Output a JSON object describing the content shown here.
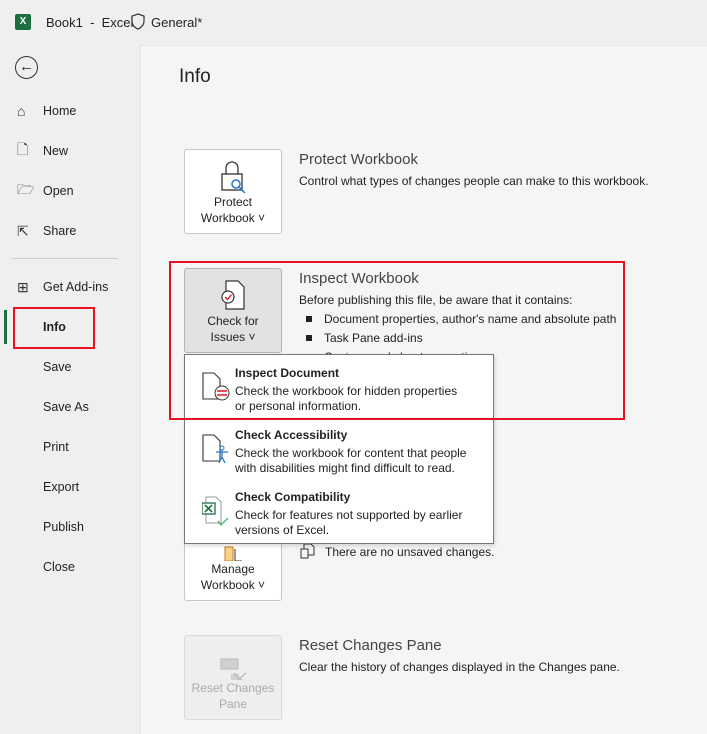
{
  "titlebar": {
    "app_icon": "excel-logo",
    "app_letter": "X",
    "title": "Book1  -  Excel",
    "sensitivity_icon": "shield-icon",
    "sensitivity_label": "General*"
  },
  "sidebar": {
    "back_icon": "back-arrow-icon",
    "items": [
      {
        "label": "Home",
        "icon": "home-icon"
      },
      {
        "label": "New",
        "icon": "new-doc-icon"
      },
      {
        "label": "Open",
        "icon": "folder-open-icon"
      },
      {
        "label": "Share",
        "icon": "share-icon"
      },
      {
        "label": "Get Add-ins",
        "icon": "grid-icon"
      },
      {
        "label": "Info",
        "selected": true
      },
      {
        "label": "Save"
      },
      {
        "label": "Save As"
      },
      {
        "label": "Print"
      },
      {
        "label": "Export"
      },
      {
        "label": "Publish"
      },
      {
        "label": "Close"
      }
    ],
    "accent": "#1d6f42"
  },
  "main": {
    "title": "Info",
    "protect": {
      "button_line1": "Protect",
      "button_line2": "Workbook ˅",
      "title": "Protect Workbook",
      "desc": "Control what types of changes people can make to this workbook."
    },
    "inspect": {
      "button_line1": "Check for",
      "button_line2": "Issues ˅",
      "title": "Inspect Workbook",
      "desc": "Before publishing this file, be aware that it contains:",
      "bullets": [
        "Document properties, author's name and absolute path",
        "Task Pane add-ins",
        "Custom worksheet properties"
      ]
    },
    "manage": {
      "button_line1": "Manage",
      "button_line2": "Workbook ˅",
      "status": "There are no unsaved changes."
    },
    "reset": {
      "button_line1": "Reset Changes",
      "button_line2": "Pane",
      "title": "Reset Changes Pane",
      "desc": "Clear the history of changes displayed in the Changes pane.",
      "disabled": true
    }
  },
  "dropdown": {
    "items": [
      {
        "title": "Inspect Document",
        "desc_line1": "Check the workbook for hidden properties",
        "desc_line2": "or personal information.",
        "icon": "inspect-document-icon"
      },
      {
        "title": "Check Accessibility",
        "desc_line1": "Check the workbook for content that people",
        "desc_line2": "with disabilities might find difficult to read.",
        "icon": "accessibility-icon"
      },
      {
        "title": "Check Compatibility",
        "desc_line1": "Check for features not supported by earlier",
        "desc_line2": "versions of Excel.",
        "icon": "compatibility-icon"
      }
    ]
  },
  "highlight_color": "#e81123"
}
